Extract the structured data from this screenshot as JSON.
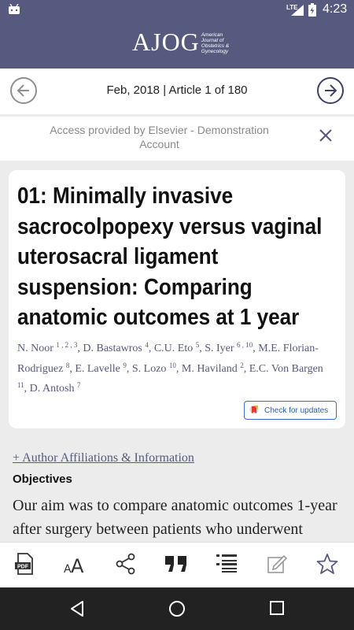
{
  "status_bar": {
    "network": "LTE",
    "time": "4:23"
  },
  "app_bar": {
    "logo_text": "AJOG",
    "logo_subtext": [
      "American",
      "Journal of",
      "Obstetrics &",
      "Gynecology"
    ]
  },
  "issue_nav": {
    "date": "Feb, 2018",
    "separator": "|",
    "article_position": "Article 1 of 180"
  },
  "access_banner": {
    "text": "Access provided by Elsevier - Demonstration Account"
  },
  "article": {
    "title": "01: Minimally invasive sacrocolpopexy versus vaginal uterosacral ligament suspension: Comparing anatomic outcomes at 1 year",
    "authors": [
      {
        "name": "N. Noor",
        "sup": "1 , 2 , 3"
      },
      {
        "name": "D. Bastawros",
        "sup": "4"
      },
      {
        "name": "C.U. Eto",
        "sup": "5"
      },
      {
        "name": "S. Iyer",
        "sup": "6 , 10"
      },
      {
        "name": "M.E. Florian-Rodriguez",
        "sup": "8"
      },
      {
        "name": "E. Lavelle",
        "sup": "9"
      },
      {
        "name": "S. Lozo",
        "sup": "10"
      },
      {
        "name": "M. Haviland",
        "sup": "2"
      },
      {
        "name": "E.C. Von Bargen",
        "sup": "11"
      },
      {
        "name": "D. Antosh",
        "sup": "7"
      }
    ],
    "check_updates_label": "Check for updates",
    "affiliations_link": "+ Author Affiliations & Information",
    "section_heading": "Objectives",
    "abstract_text": "Our aim was to compare anatomic outcomes 1-year after surgery between patients who underwent"
  },
  "toolbar": {
    "icons": [
      "pdf-icon",
      "text-size-icon",
      "share-icon",
      "quote-icon",
      "outline-icon",
      "notes-icon",
      "bookmark-star-icon"
    ],
    "pdf_label": "PDF",
    "text_size_label": "AA"
  },
  "colors": {
    "brand": "#555a7e",
    "link": "#555a7e",
    "check_updates": "#2b5fae"
  }
}
